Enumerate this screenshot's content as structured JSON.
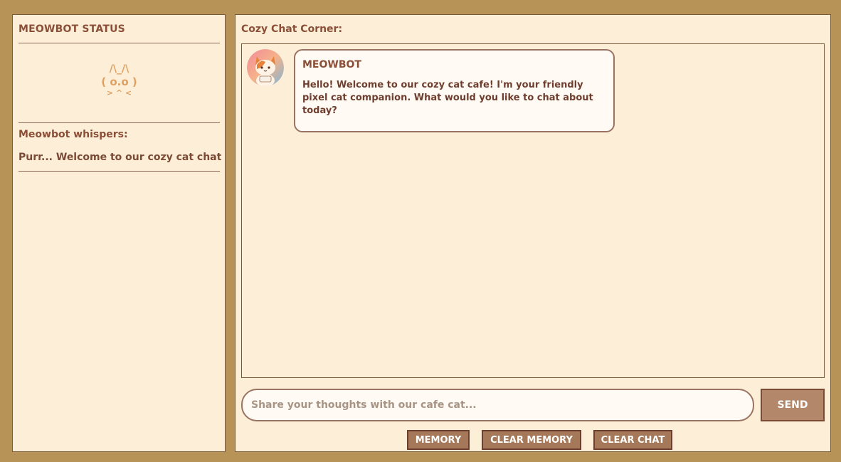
{
  "sidebar": {
    "title": "MEOWBOT STATUS",
    "ascii_cat": {
      "line1": "/\\_/\\",
      "line2": "( o.o )",
      "line3": "> ^ <"
    },
    "whisper_label": "Meowbot whispers:",
    "whisper_text": "Purr... Welcome to our cozy cat chat"
  },
  "main": {
    "title": "Cozy Chat Corner:",
    "messages": [
      {
        "sender": "MEOWBOT",
        "text": "Hello! Welcome to our cozy cat cafe! I'm your friendly pixel cat companion. What would you like to chat about today?",
        "avatar_icon": "cat-avatar-icon"
      }
    ],
    "input": {
      "placeholder": "Share your thoughts with our cafe cat...",
      "value": ""
    },
    "send_label": "SEND",
    "buttons": {
      "memory": "MEMORY",
      "clear_memory": "CLEAR MEMORY",
      "clear_chat": "CLEAR CHAT"
    }
  },
  "colors": {
    "background": "#b89358",
    "panel": "#fdeed8",
    "accent_text": "#8b4f38",
    "button": "#a47858"
  }
}
